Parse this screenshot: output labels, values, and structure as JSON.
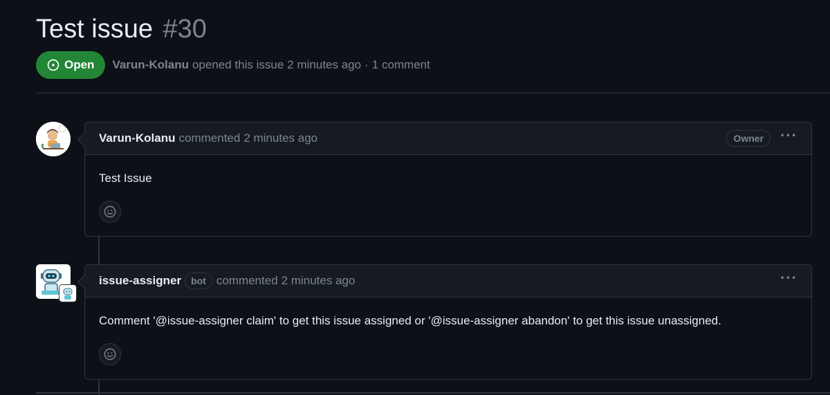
{
  "issue": {
    "title": "Test issue",
    "number": "#30",
    "state_label": "Open",
    "author": "Varun-Kolanu",
    "opened_text": "opened this issue",
    "opened_time": "2 minutes ago",
    "separator": "·",
    "comment_count": "1 comment"
  },
  "comments": [
    {
      "author": "Varun-Kolanu",
      "action": "commented",
      "time": "2 minutes ago",
      "role": "Owner",
      "body": "Test Issue",
      "menu": "···"
    },
    {
      "author": "issue-assigner",
      "bot_label": "bot",
      "action": "commented",
      "time": "2 minutes ago",
      "body": "Comment '@issue-assigner claim' to get this issue assigned or '@issue-assigner abandon' to get this issue unassigned.",
      "menu": "···"
    }
  ],
  "colors": {
    "background": "#0d1117",
    "header_bg": "#161b22",
    "border": "#30363d",
    "open_green": "#238636",
    "muted_text": "#7d8590",
    "primary_text": "#e6edf3"
  },
  "icons": {
    "state": "issue-opened-icon",
    "reaction": "smiley-icon",
    "menu": "kebab-horizontal-icon"
  }
}
